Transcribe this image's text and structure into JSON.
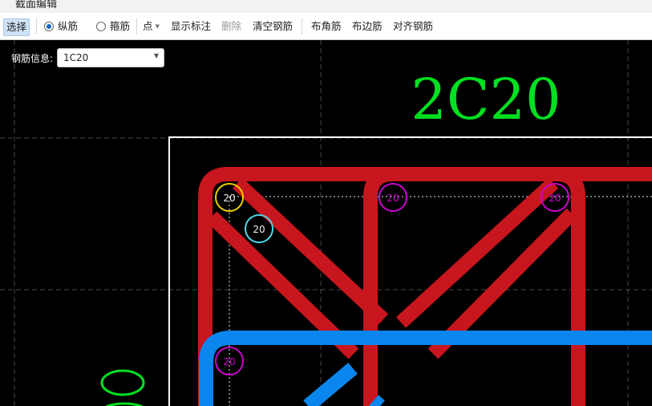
{
  "window": {
    "title": "截面编辑"
  },
  "toolbar": {
    "select": "选择",
    "longitudinal": "纵筋",
    "stirrup": "箍筋",
    "point": "点",
    "show_annotation": "显示标注",
    "delete": "删除",
    "clear_rebar": "清空钢筋",
    "place_corner": "布角筋",
    "place_edge": "布边筋",
    "align_rebar": "对齐钢筋"
  },
  "rebar_info": {
    "label": "钢筋信息:",
    "value": "1C20"
  },
  "canvas": {
    "annotation_text": "2C20",
    "rebar_labels": [
      "20",
      "20",
      "20",
      "20",
      "20"
    ]
  },
  "colors": {
    "background": "#000000",
    "stirrup_red": "#c8161e",
    "stirrup_blue": "#0a86ee",
    "corner_bar": "#f0d000",
    "selected_bar": "#4fd8e8",
    "edge_bar": "#d000d0",
    "annotation_green": "#00e020",
    "section_outline": "#ffffff"
  }
}
